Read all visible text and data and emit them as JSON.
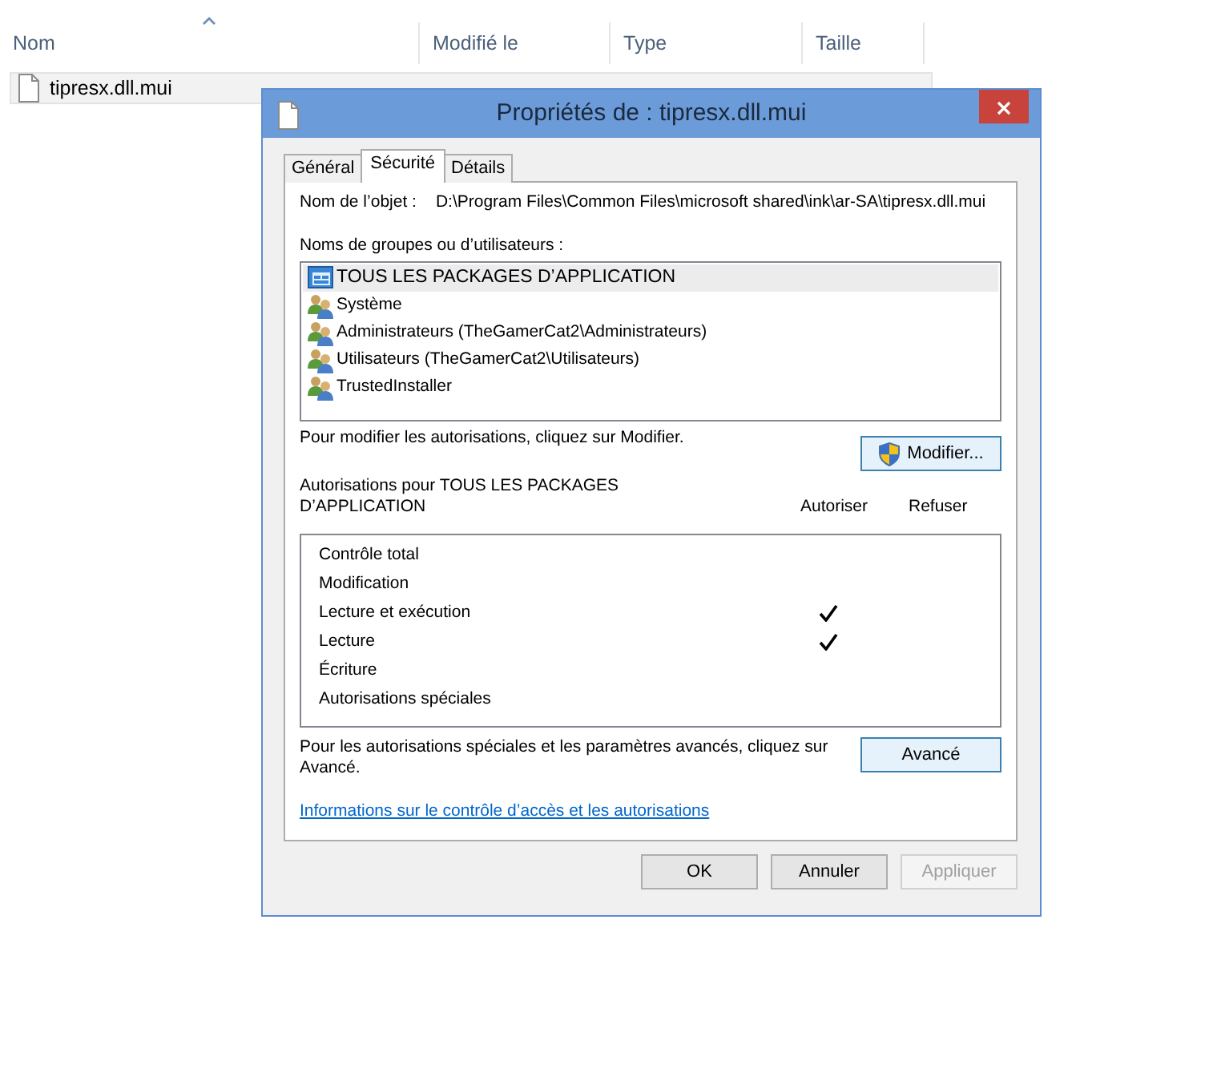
{
  "explorer": {
    "columns": [
      {
        "label": "Nom",
        "sorted": true
      },
      {
        "label": "Modifié le",
        "sorted": false
      },
      {
        "label": "Type",
        "sorted": false
      },
      {
        "label": "Taille",
        "sorted": false
      }
    ],
    "files": [
      {
        "name": "tipresx.dll.mui",
        "selected": true
      }
    ]
  },
  "dialog": {
    "title": "Propriétés de : tipresx.dll.mui",
    "tabs": [
      {
        "label": "Général",
        "selected": false
      },
      {
        "label": "Sécurité",
        "selected": true
      },
      {
        "label": "Détails",
        "selected": false
      }
    ],
    "object_label": "Nom de l’objet :",
    "object_path": "D:\\Program Files\\Common Files\\microsoft shared\\ink\\ar-SA\\tipresx.dll.mui",
    "groups_label": "Noms de groupes ou d’utilisateurs :",
    "groups": [
      {
        "name": "TOUS LES PACKAGES D’APPLICATION",
        "kind": "package",
        "selected": true
      },
      {
        "name": "Système",
        "kind": "users",
        "selected": false
      },
      {
        "name": "Administrateurs (TheGamerCat2\\Administrateurs)",
        "kind": "users",
        "selected": false
      },
      {
        "name": "Utilisateurs (TheGamerCat2\\Utilisateurs)",
        "kind": "users",
        "selected": false
      },
      {
        "name": "TrustedInstaller",
        "kind": "users",
        "selected": false
      }
    ],
    "modify_hint": "Pour modifier les autorisations, cliquez sur Modifier.",
    "modify_button": "Modifier...",
    "permissions_label": "Autorisations pour TOUS LES PACKAGES D’APPLICATION",
    "allow_header": "Autoriser",
    "deny_header": "Refuser",
    "permissions": [
      {
        "name": "Contrôle total",
        "allow": false,
        "deny": false
      },
      {
        "name": "Modification",
        "allow": false,
        "deny": false
      },
      {
        "name": "Lecture et exécution",
        "allow": true,
        "deny": false
      },
      {
        "name": "Lecture",
        "allow": true,
        "deny": false
      },
      {
        "name": "Écriture",
        "allow": false,
        "deny": false
      },
      {
        "name": "Autorisations spéciales",
        "allow": false,
        "deny": false
      }
    ],
    "advanced_hint": "Pour les autorisations spéciales et les paramètres avancés, cliquez sur Avancé.",
    "advanced_button": "Avancé",
    "help_link": "Informations sur le contrôle d’accès et les autorisations",
    "buttons": [
      {
        "label": "OK",
        "disabled": false
      },
      {
        "label": "Annuler",
        "disabled": false
      },
      {
        "label": "Appliquer",
        "disabled": true
      }
    ]
  }
}
